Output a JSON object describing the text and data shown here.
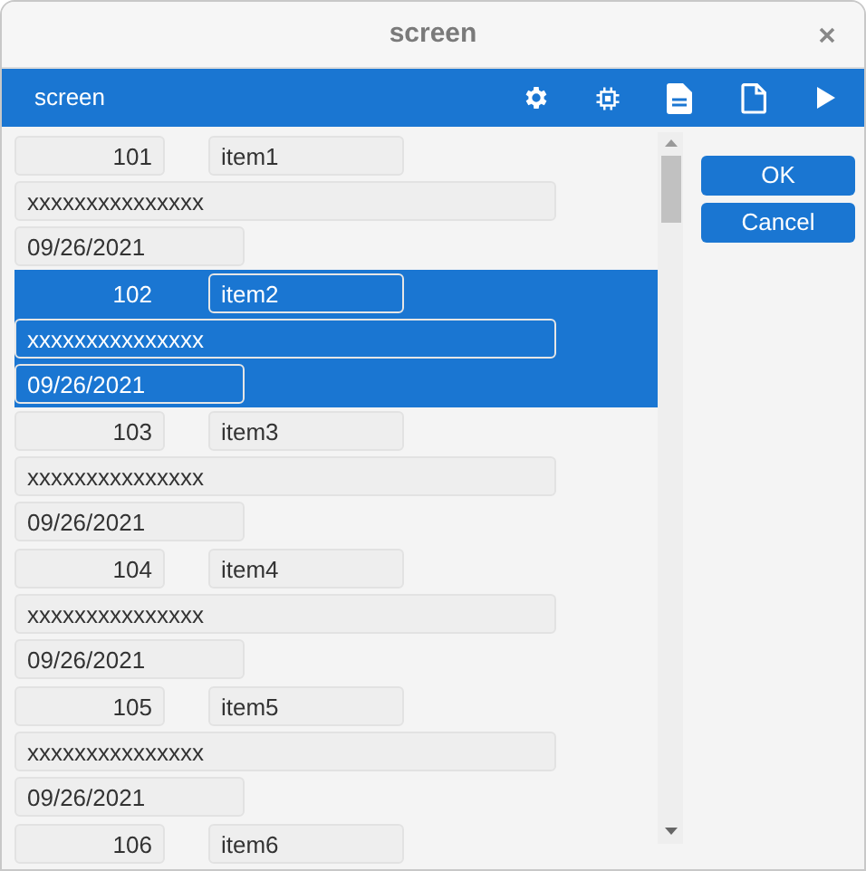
{
  "window": {
    "title": "screen"
  },
  "toolbar": {
    "title": "screen"
  },
  "records": [
    {
      "number": "101",
      "name": "item1",
      "description": "xxxxxxxxxxxxxxx",
      "date": "09/26/2021",
      "selected": false
    },
    {
      "number": "102",
      "name": "item2",
      "description": "xxxxxxxxxxxxxxx",
      "date": "09/26/2021",
      "selected": true
    },
    {
      "number": "103",
      "name": "item3",
      "description": "xxxxxxxxxxxxxxx",
      "date": "09/26/2021",
      "selected": false
    },
    {
      "number": "104",
      "name": "item4",
      "description": "xxxxxxxxxxxxxxx",
      "date": "09/26/2021",
      "selected": false
    },
    {
      "number": "105",
      "name": "item5",
      "description": "xxxxxxxxxxxxxxx",
      "date": "09/26/2021",
      "selected": false
    },
    {
      "number": "106",
      "name": "item6",
      "selected": false
    }
  ],
  "buttons": [
    "OK",
    "Cancel"
  ]
}
